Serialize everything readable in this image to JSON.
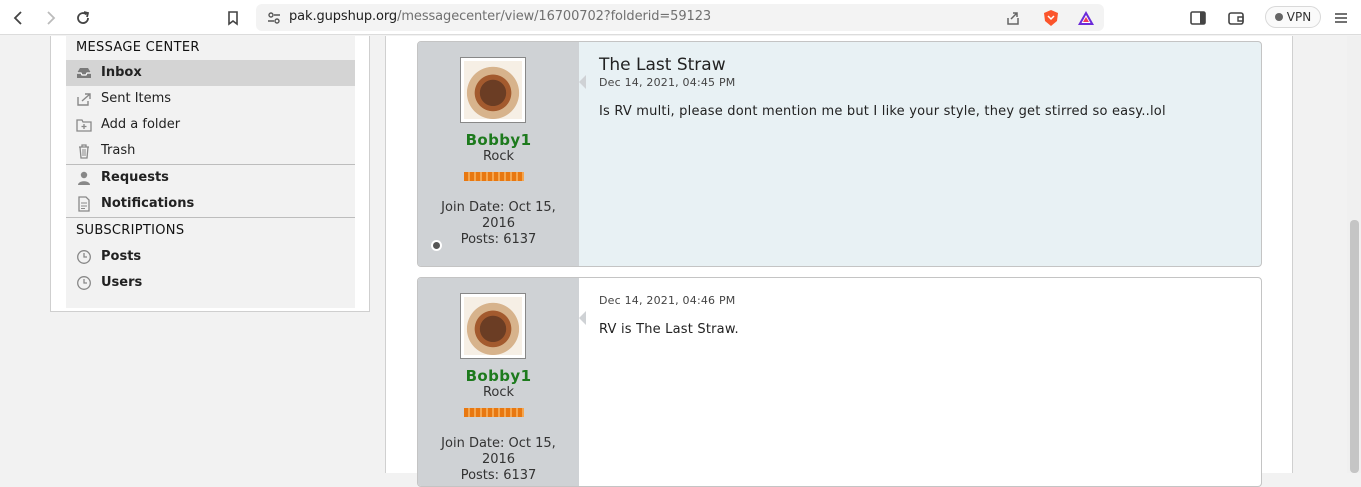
{
  "browser": {
    "url_host": "pak.gupshup.org",
    "url_path": "/messagecenter/view/16700702?folderid=59123",
    "vpn_label": "VPN"
  },
  "sidebar": {
    "message_center_title": "MESSAGE CENTER",
    "folders": [
      {
        "label": "Inbox",
        "icon": "inbox-icon"
      },
      {
        "label": "Sent Items",
        "icon": "sent-icon"
      },
      {
        "label": "Add a folder",
        "icon": "add-folder-icon"
      },
      {
        "label": "Trash",
        "icon": "trash-icon"
      }
    ],
    "extras": [
      {
        "label": "Requests",
        "icon": "user-icon"
      },
      {
        "label": "Notifications",
        "icon": "document-icon"
      }
    ],
    "subscriptions_title": "SUBSCRIPTIONS",
    "subscriptions": [
      {
        "label": "Posts",
        "icon": "clock-icon"
      },
      {
        "label": "Users",
        "icon": "clock-icon"
      }
    ]
  },
  "posts": [
    {
      "username": "Bobby1",
      "rank": "Rock",
      "join_date": "Join Date: Oct 15, 2016",
      "posts": "Posts: 6137",
      "title": "The Last Straw",
      "date": "Dec 14, 2021, 04:45 PM",
      "text": "Is RV multi, please dont mention me but I like your style, they get stirred so easy..lol"
    },
    {
      "username": "Bobby1",
      "rank": "Rock",
      "join_date": "Join Date: Oct 15, 2016",
      "posts": "Posts: 6137",
      "title": "",
      "date": "Dec 14, 2021, 04:46 PM",
      "text": "RV is The Last Straw."
    }
  ],
  "colors": {
    "username": "#1d7a1d",
    "post_bg_highlight": "#e8f1f4",
    "userinfo_bg": "#cfd2d5"
  }
}
